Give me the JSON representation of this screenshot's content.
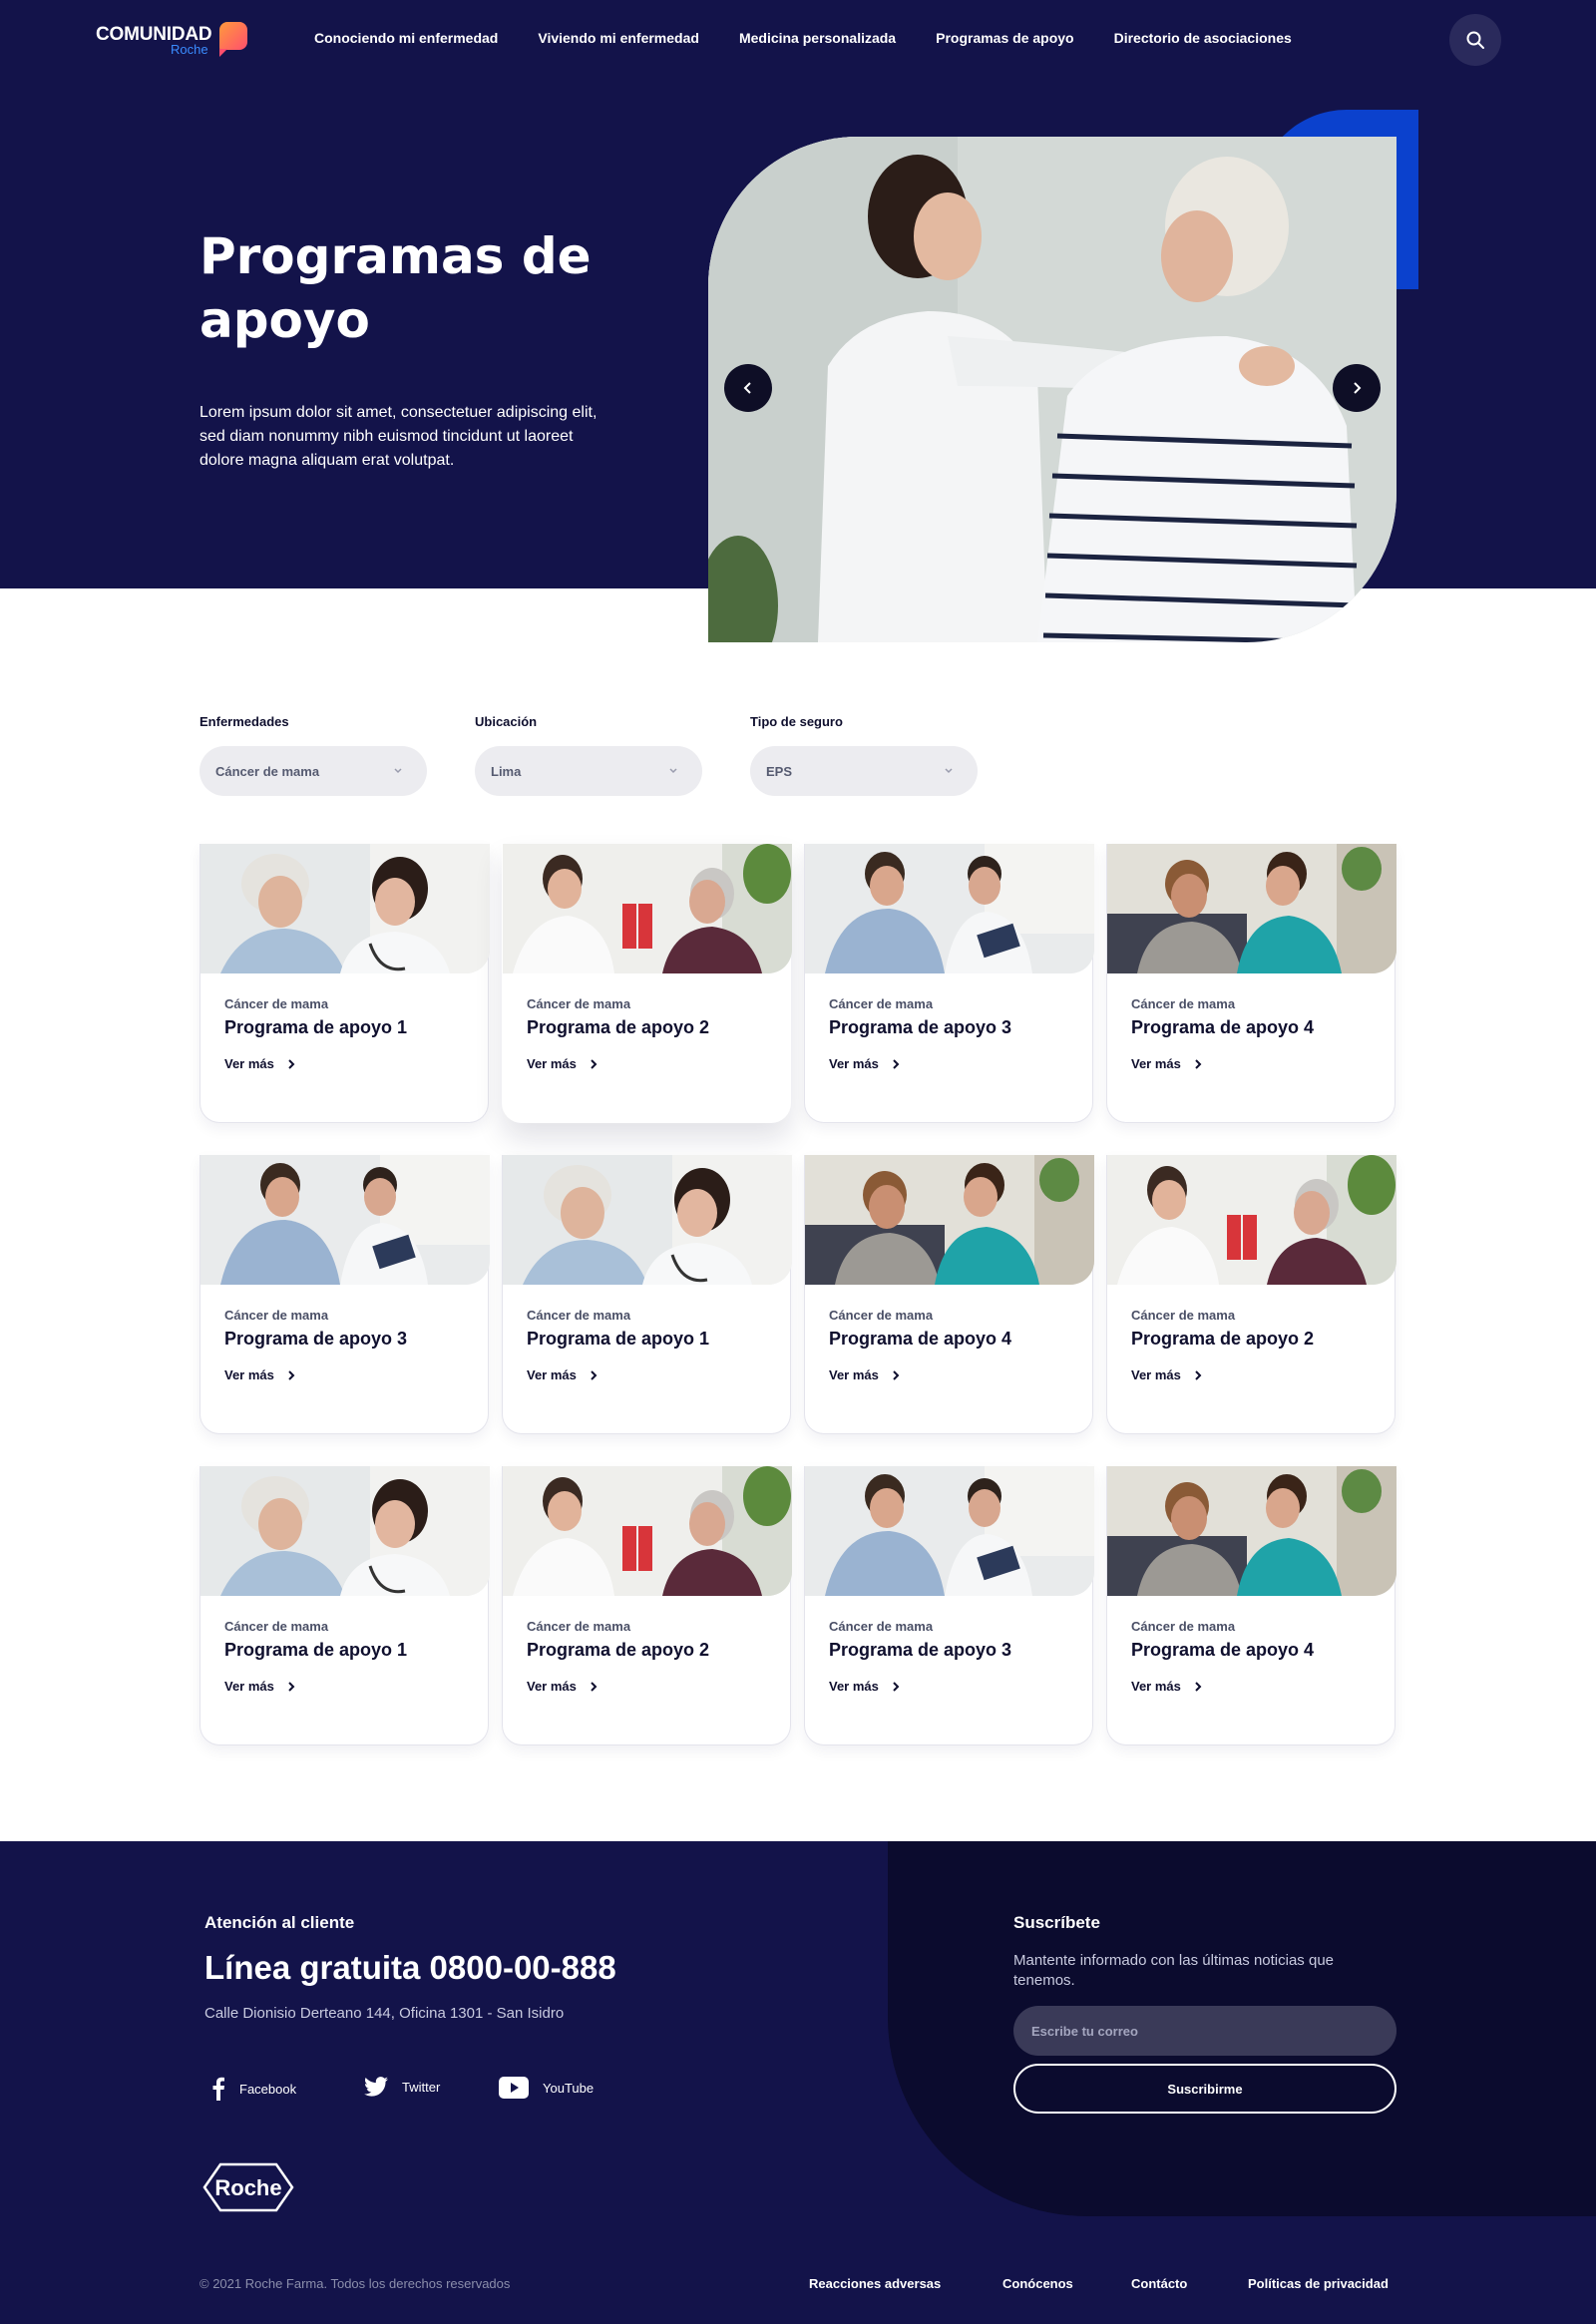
{
  "header": {
    "logo_main": "COMUNIDAD",
    "logo_sub": "Roche",
    "nav": [
      {
        "label": "Conociendo mi enfermedad"
      },
      {
        "label": "Viviendo mi enfermedad"
      },
      {
        "label": "Medicina personalizada"
      },
      {
        "label": "Programas de apoyo"
      },
      {
        "label": "Directorio de asociaciones"
      }
    ]
  },
  "hero": {
    "title": "Programas de apoyo",
    "description": "Lorem ipsum dolor sit amet, consectetuer adipiscing elit, sed diam nonummy nibh euismod tincidunt ut laoreet dolore magna aliquam erat volutpat."
  },
  "filters": [
    {
      "label": "Enfermedades",
      "value": "Cáncer de mama"
    },
    {
      "label": "Ubicación",
      "value": "Lima"
    },
    {
      "label": "Tipo de seguro",
      "value": "EPS"
    }
  ],
  "cards": [
    {
      "category": "Cáncer de mama",
      "title": "Programa de apoyo 1",
      "link": "Ver más"
    },
    {
      "category": "Cáncer de mama",
      "title": "Programa de apoyo 2",
      "link": "Ver más"
    },
    {
      "category": "Cáncer de mama",
      "title": "Programa de apoyo 3",
      "link": "Ver más"
    },
    {
      "category": "Cáncer de mama",
      "title": "Programa de apoyo 4",
      "link": "Ver más"
    },
    {
      "category": "Cáncer de mama",
      "title": "Programa de apoyo 3",
      "link": "Ver más"
    },
    {
      "category": "Cáncer de mama",
      "title": "Programa de apoyo 1",
      "link": "Ver más"
    },
    {
      "category": "Cáncer de mama",
      "title": "Programa de apoyo 4",
      "link": "Ver más"
    },
    {
      "category": "Cáncer de mama",
      "title": "Programa de apoyo 2",
      "link": "Ver más"
    },
    {
      "category": "Cáncer de mama",
      "title": "Programa de apoyo 1",
      "link": "Ver más"
    },
    {
      "category": "Cáncer de mama",
      "title": "Programa de apoyo 2",
      "link": "Ver más"
    },
    {
      "category": "Cáncer de mama",
      "title": "Programa de apoyo 3",
      "link": "Ver más"
    },
    {
      "category": "Cáncer de mama",
      "title": "Programa de apoyo 4",
      "link": "Ver más"
    }
  ],
  "footer": {
    "contact_label": "Atención al cliente",
    "phone": "Línea gratuita 0800-00-888",
    "address": "Calle Dionisio Derteano 144, Oficina 1301 - San Isidro",
    "social": [
      {
        "label": "Facebook",
        "icon": "facebook-icon"
      },
      {
        "label": "Twitter",
        "icon": "twitter-icon"
      },
      {
        "label": "YouTube",
        "icon": "youtube-icon"
      }
    ],
    "brand": "Roche",
    "subscribe_title": "Suscríbete",
    "subscribe_text": "Mantente informado con las últimas noticias que tenemos.",
    "email_placeholder": "Escribe tu correo",
    "subscribe_button": "Suscribirme",
    "copyright": "© 2021 Roche Farma. Todos los derechos reservados",
    "links": [
      {
        "label": "Reacciones adversas"
      },
      {
        "label": "Conócenos"
      },
      {
        "label": "Contácto"
      },
      {
        "label": "Políticas de privacidad"
      }
    ]
  },
  "colors": {
    "navy": "#13134a",
    "footer_dark": "#0b0b2e",
    "accent_blue": "#0b41cd",
    "logo_orange": "#ff9a3c",
    "logo_pink": "#ff4f6d"
  }
}
